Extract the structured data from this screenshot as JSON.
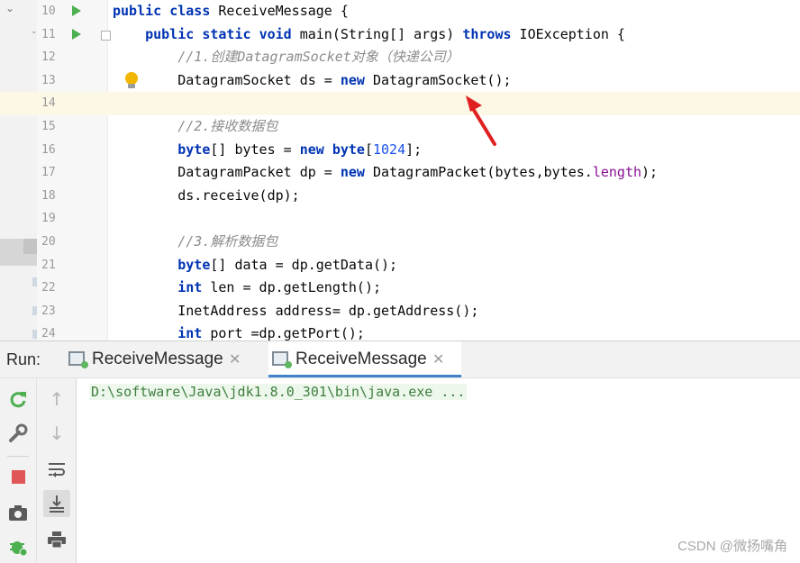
{
  "editor": {
    "lines": [
      {
        "num": "10",
        "run": true,
        "fold": false,
        "bulb": false,
        "current": false,
        "tokens": [
          [
            "kw",
            "public"
          ],
          [
            "t",
            " "
          ],
          [
            "kw",
            "class"
          ],
          [
            "t",
            " ReceiveMessage {"
          ]
        ]
      },
      {
        "num": "11",
        "run": true,
        "fold": true,
        "bulb": false,
        "current": false,
        "tokens": [
          [
            "t",
            "    "
          ],
          [
            "kw",
            "public"
          ],
          [
            "t",
            " "
          ],
          [
            "kw",
            "static"
          ],
          [
            "t",
            " "
          ],
          [
            "kw",
            "void"
          ],
          [
            "t",
            " main(String[] args) "
          ],
          [
            "kw",
            "throws"
          ],
          [
            "t",
            " IOException {"
          ]
        ]
      },
      {
        "num": "12",
        "run": false,
        "fold": false,
        "bulb": false,
        "current": false,
        "tokens": [
          [
            "t",
            "        "
          ],
          [
            "cm",
            "//1.创建DatagramSocket对象（快递公司）"
          ]
        ]
      },
      {
        "num": "13",
        "run": false,
        "fold": false,
        "bulb": true,
        "current": false,
        "tokens": [
          [
            "t",
            "        DatagramSocket ds = "
          ],
          [
            "kw",
            "new"
          ],
          [
            "t",
            " DatagramSocket();"
          ]
        ]
      },
      {
        "num": "14",
        "run": false,
        "fold": false,
        "bulb": false,
        "current": true,
        "tokens": []
      },
      {
        "num": "15",
        "run": false,
        "fold": false,
        "bulb": false,
        "current": false,
        "tokens": [
          [
            "t",
            "        "
          ],
          [
            "cm",
            "//2.接收数据包"
          ]
        ]
      },
      {
        "num": "16",
        "run": false,
        "fold": false,
        "bulb": false,
        "current": false,
        "tokens": [
          [
            "t",
            "        "
          ],
          [
            "kw",
            "byte"
          ],
          [
            "t",
            "[] bytes = "
          ],
          [
            "kw",
            "new"
          ],
          [
            "t",
            " "
          ],
          [
            "kw",
            "byte"
          ],
          [
            "t",
            "["
          ],
          [
            "num",
            "1024"
          ],
          [
            "t",
            "];"
          ]
        ]
      },
      {
        "num": "17",
        "run": false,
        "fold": false,
        "bulb": false,
        "current": false,
        "tokens": [
          [
            "t",
            "        DatagramPacket dp = "
          ],
          [
            "kw",
            "new"
          ],
          [
            "t",
            " DatagramPacket(bytes,bytes."
          ],
          [
            "fld",
            "length"
          ],
          [
            "t",
            ");"
          ]
        ]
      },
      {
        "num": "18",
        "run": false,
        "fold": false,
        "bulb": false,
        "current": false,
        "tokens": [
          [
            "t",
            "        ds.receive(dp);"
          ]
        ]
      },
      {
        "num": "19",
        "run": false,
        "fold": false,
        "bulb": false,
        "current": false,
        "tokens": []
      },
      {
        "num": "20",
        "run": false,
        "fold": false,
        "bulb": false,
        "current": false,
        "tokens": [
          [
            "t",
            "        "
          ],
          [
            "cm",
            "//3.解析数据包"
          ]
        ]
      },
      {
        "num": "21",
        "run": false,
        "fold": false,
        "bulb": false,
        "current": false,
        "tokens": [
          [
            "t",
            "        "
          ],
          [
            "kw",
            "byte"
          ],
          [
            "t",
            "[] data = dp.getData();"
          ]
        ]
      },
      {
        "num": "22",
        "run": false,
        "fold": false,
        "bulb": false,
        "current": false,
        "tokens": [
          [
            "t",
            "        "
          ],
          [
            "kw",
            "int"
          ],
          [
            "t",
            " len = dp.getLength();"
          ]
        ]
      },
      {
        "num": "23",
        "run": false,
        "fold": false,
        "bulb": false,
        "current": false,
        "tokens": [
          [
            "t",
            "        InetAddress address= dp.getAddress();"
          ]
        ]
      },
      {
        "num": "24",
        "run": false,
        "fold": false,
        "bulb": false,
        "current": false,
        "tokens": [
          [
            "t",
            "        "
          ],
          [
            "kw",
            "int"
          ],
          [
            "t",
            " port =dp.getPort();"
          ]
        ]
      }
    ]
  },
  "run_panel": {
    "label": "Run:",
    "tabs": [
      {
        "label": "ReceiveMessage",
        "active": false
      },
      {
        "label": "ReceiveMessage",
        "active": true
      }
    ],
    "close_glyph": "✕",
    "console_text": "D:\\software\\Java\\jdk1.8.0_301\\bin\\java.exe ...",
    "tools_left": [
      "rerun-icon",
      "wrench-icon",
      "stop-icon",
      "camera-icon",
      "debug-bug-icon"
    ],
    "tools_right": [
      "arrow-up-icon",
      "arrow-down-icon",
      "soft-wrap-icon",
      "scroll-to-end-icon",
      "print-icon"
    ]
  },
  "watermark": "CSDN @微扬嘴角",
  "colors": {
    "keyword": "#0033b3",
    "comment": "#8c8c8c",
    "number": "#1750eb",
    "field": "#871094",
    "console_text": "#3f7f3f",
    "arrow": "#e02020",
    "current_line": "#fdf8e6"
  }
}
